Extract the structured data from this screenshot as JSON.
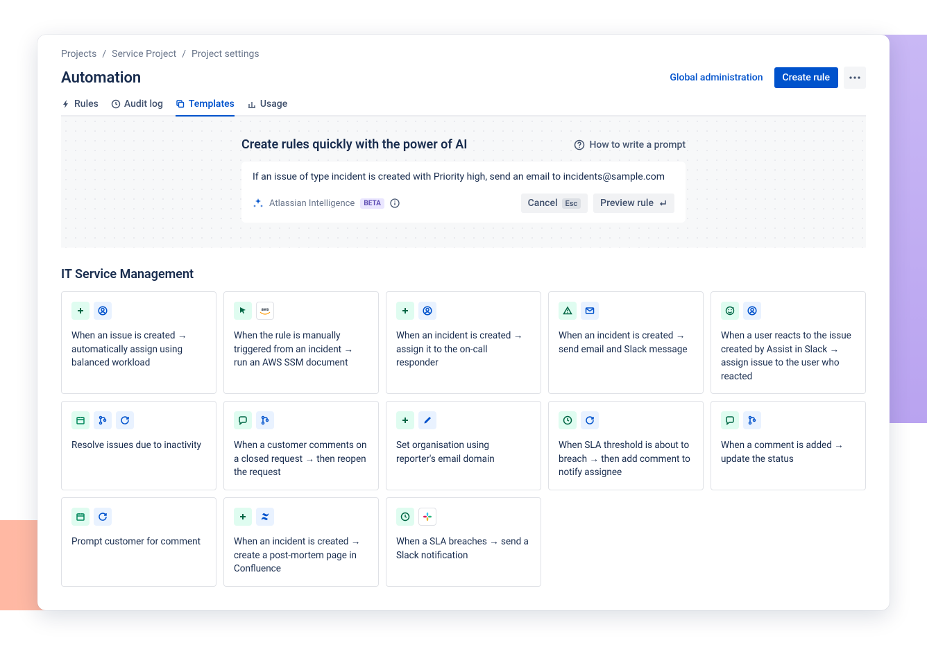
{
  "breadcrumb": [
    "Projects",
    "Service Project",
    "Project settings"
  ],
  "page_title": "Automation",
  "header": {
    "global_admin": "Global administration",
    "create_rule": "Create rule"
  },
  "tabs": [
    {
      "label": "Rules",
      "icon": "bolt",
      "active": false
    },
    {
      "label": "Audit log",
      "icon": "clock",
      "active": false
    },
    {
      "label": "Templates",
      "icon": "copy",
      "active": true
    },
    {
      "label": "Usage",
      "icon": "chart",
      "active": false
    }
  ],
  "ai": {
    "title": "Create rules quickly with the power of AI",
    "help": "How to write a prompt",
    "prompt": "If an issue of type incident is created with Priority high, send an email to incidents@sample.com",
    "brand": "Atlassian Intelligence",
    "beta": "BETA",
    "cancel": "Cancel",
    "esc": "Esc",
    "preview": "Preview rule"
  },
  "section_title": "IT Service Management",
  "cards": [
    {
      "icons": [
        {
          "t": "plus",
          "c": "green"
        },
        {
          "t": "user",
          "c": "blue"
        }
      ],
      "text": "When an issue is created → automatically assign using balanced workload"
    },
    {
      "icons": [
        {
          "t": "cursor",
          "c": "green"
        },
        {
          "t": "aws",
          "c": "white"
        }
      ],
      "text": "When the rule is manually triggered from an incident → run an AWS SSM document"
    },
    {
      "icons": [
        {
          "t": "plus",
          "c": "green"
        },
        {
          "t": "user",
          "c": "blue"
        }
      ],
      "text": "When an incident is created → assign it to the on-call responder"
    },
    {
      "icons": [
        {
          "t": "warn",
          "c": "green"
        },
        {
          "t": "mail",
          "c": "blue"
        }
      ],
      "text": "When an incident is created → send email and Slack message"
    },
    {
      "icons": [
        {
          "t": "emoji",
          "c": "green"
        },
        {
          "t": "user",
          "c": "blue"
        }
      ],
      "text": "When a user reacts to the issue created by Assist in Slack → assign issue to the user who reacted"
    },
    {
      "icons": [
        {
          "t": "cal",
          "c": "lgreen"
        },
        {
          "t": "branch",
          "c": "blue"
        },
        {
          "t": "refresh",
          "c": "blue"
        }
      ],
      "text": "Resolve issues due to inactivity"
    },
    {
      "icons": [
        {
          "t": "comment",
          "c": "green"
        },
        {
          "t": "branch",
          "c": "blue"
        }
      ],
      "text": "When a customer comments on a closed request → then reopen the request"
    },
    {
      "icons": [
        {
          "t": "plus",
          "c": "green"
        },
        {
          "t": "pencil",
          "c": "blue"
        }
      ],
      "text": "Set organisation using reporter's email domain"
    },
    {
      "icons": [
        {
          "t": "clock",
          "c": "green"
        },
        {
          "t": "refresh",
          "c": "blue"
        }
      ],
      "text": "When SLA threshold is about to breach → then add comment to notify assignee"
    },
    {
      "icons": [
        {
          "t": "comment",
          "c": "green"
        },
        {
          "t": "branch",
          "c": "blue"
        }
      ],
      "text": "When a comment is added → update the status"
    },
    {
      "icons": [
        {
          "t": "cal",
          "c": "lgreen"
        },
        {
          "t": "refresh",
          "c": "blue"
        }
      ],
      "text": "Prompt customer for comment"
    },
    {
      "icons": [
        {
          "t": "plus",
          "c": "green"
        },
        {
          "t": "confluence",
          "c": "blue"
        }
      ],
      "text": "When an incident is created → create a post-mortem page in Confluence"
    },
    {
      "icons": [
        {
          "t": "clock",
          "c": "green"
        },
        {
          "t": "slack",
          "c": "white"
        }
      ],
      "text": "When a SLA breaches → send a Slack notification"
    }
  ]
}
